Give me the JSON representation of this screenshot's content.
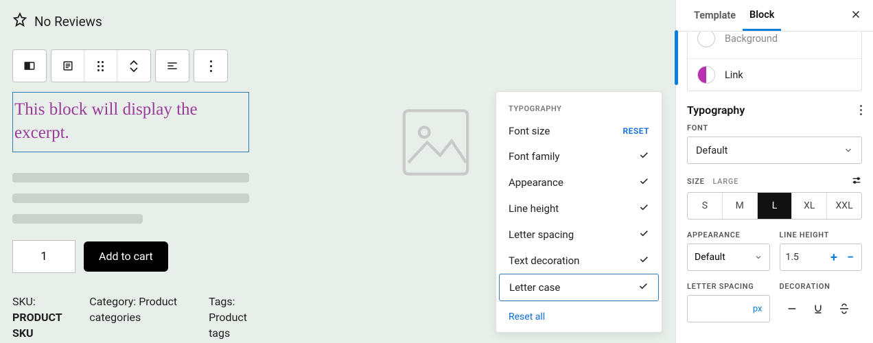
{
  "reviews": {
    "text": "No Reviews"
  },
  "excerpt": {
    "text": "This block will display the excerpt."
  },
  "qty": {
    "value": "1"
  },
  "cart": {
    "add_label": "Add to cart"
  },
  "meta": {
    "sku_label": "SKU:",
    "sku_value": "PRODUCT SKU",
    "category_label": "Category:",
    "category_value": "Product categories",
    "tags_label": "Tags:",
    "tags_value": "Product tags"
  },
  "popover": {
    "title": "TYPOGRAPHY",
    "items": {
      "font_size": "Font size",
      "font_family": "Font family",
      "appearance": "Appearance",
      "line_height": "Line height",
      "letter_spacing": "Letter spacing",
      "text_decoration": "Text decoration",
      "letter_case": "Letter case"
    },
    "reset": "RESET",
    "reset_all": "Reset all"
  },
  "sidebar": {
    "tabs": {
      "template": "Template",
      "block": "Block"
    },
    "colors": {
      "background": "Background",
      "link": "Link"
    },
    "typography": {
      "title": "Typography",
      "font_label": "FONT",
      "font_value": "Default",
      "size_label": "SIZE",
      "size_sub": "LARGE",
      "sizes": {
        "s": "S",
        "m": "M",
        "l": "L",
        "xl": "XL",
        "xxl": "XXL"
      },
      "appearance_label": "APPEARANCE",
      "appearance_value": "Default",
      "lineheight_label": "LINE HEIGHT",
      "lineheight_value": "1.5",
      "letterspacing_label": "LETTER SPACING",
      "letterspacing_unit": "px",
      "decoration_label": "DECORATION"
    }
  }
}
